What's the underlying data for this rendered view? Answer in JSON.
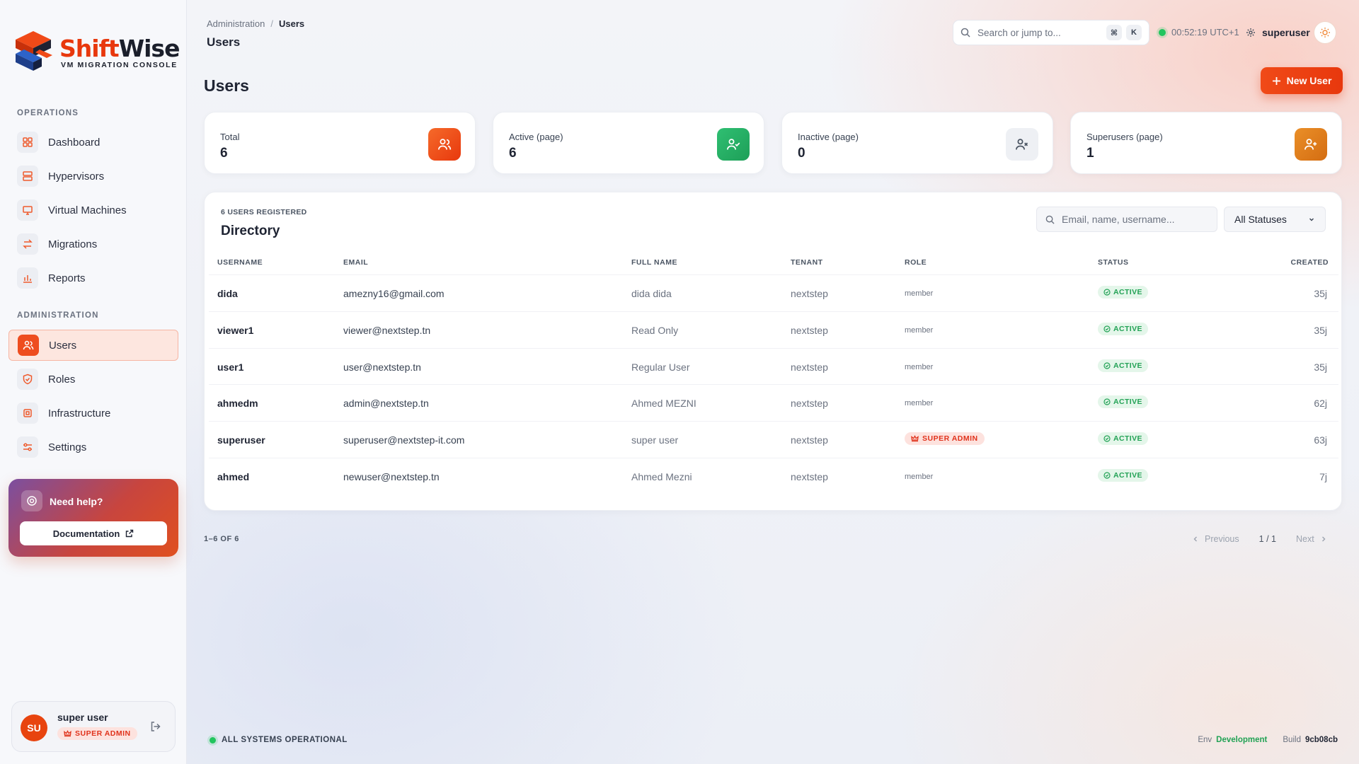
{
  "brand": {
    "name_part1": "Shift",
    "name_part2": "Wise",
    "subtitle": "VM MIGRATION CONSOLE",
    "accent_color": "#e8380d"
  },
  "sidebar": {
    "sections": [
      {
        "label": "OPERATIONS"
      },
      {
        "label": "ADMINISTRATION"
      }
    ],
    "items": [
      {
        "label": "Dashboard",
        "icon": "grid-icon"
      },
      {
        "label": "Hypervisors",
        "icon": "server-icon"
      },
      {
        "label": "Virtual Machines",
        "icon": "monitor-icon"
      },
      {
        "label": "Migrations",
        "icon": "swap-icon"
      },
      {
        "label": "Reports",
        "icon": "bar-chart-icon"
      },
      {
        "label": "Users",
        "icon": "users-icon",
        "active": true
      },
      {
        "label": "Roles",
        "icon": "shield-icon"
      },
      {
        "label": "Infrastructure",
        "icon": "cpu-icon"
      },
      {
        "label": "Settings",
        "icon": "sliders-icon"
      }
    ],
    "help": {
      "title": "Need help?",
      "button": "Documentation"
    },
    "user": {
      "initials": "SU",
      "name": "super user",
      "badge": "SUPER ADMIN"
    }
  },
  "header": {
    "breadcrumb": [
      "Administration",
      "Users"
    ],
    "title": "Users",
    "search_placeholder": "Search or jump to...",
    "shortcut": [
      "⌘",
      "K"
    ],
    "clock": "00:52:19 UTC+1",
    "username": "superuser"
  },
  "page": {
    "title": "Users",
    "new_button": "New User"
  },
  "stats": [
    {
      "label": "Total",
      "value": "6",
      "color": "#ee4d1f"
    },
    {
      "label": "Active (page)",
      "value": "6",
      "color": "#22a560"
    },
    {
      "label": "Inactive (page)",
      "value": "0",
      "color": "#eef0f4"
    },
    {
      "label": "Superusers (page)",
      "value": "1",
      "color": "#e07b1a"
    }
  ],
  "directory": {
    "kicker": "6 USERS REGISTERED",
    "title": "Directory",
    "search_placeholder": "Email, name, username...",
    "status_filter": "All Statuses",
    "columns": [
      "USERNAME",
      "EMAIL",
      "FULL NAME",
      "TENANT",
      "ROLE",
      "STATUS",
      "CREATED"
    ],
    "rows": [
      {
        "username": "dida",
        "email": "amezny16@gmail.com",
        "full_name": "dida dida",
        "tenant": "nextstep",
        "role": "member",
        "status": "ACTIVE",
        "created": "35j"
      },
      {
        "username": "viewer1",
        "email": "viewer@nextstep.tn",
        "full_name": "Read Only",
        "tenant": "nextstep",
        "role": "member",
        "status": "ACTIVE",
        "created": "35j"
      },
      {
        "username": "user1",
        "email": "user@nextstep.tn",
        "full_name": "Regular User",
        "tenant": "nextstep",
        "role": "member",
        "status": "ACTIVE",
        "created": "35j"
      },
      {
        "username": "ahmedm",
        "email": "admin@nextstep.tn",
        "full_name": "Ahmed MEZNI",
        "tenant": "nextstep",
        "role": "member",
        "status": "ACTIVE",
        "created": "62j"
      },
      {
        "username": "superuser",
        "email": "superuser@nextstep-it.com",
        "full_name": "super user",
        "tenant": "nextstep",
        "role": "SUPER ADMIN",
        "status": "ACTIVE",
        "created": "63j"
      },
      {
        "username": "ahmed",
        "email": "newuser@nextstep.tn",
        "full_name": "Ahmed Mezni",
        "tenant": "nextstep",
        "role": "member",
        "status": "ACTIVE",
        "created": "7j"
      }
    ]
  },
  "pagination": {
    "summary": "1–6 OF 6",
    "previous": "Previous",
    "page": "1 / 1",
    "next": "Next"
  },
  "footer": {
    "status": "ALL SYSTEMS OPERATIONAL",
    "env_label": "Env",
    "env_value": "Development",
    "build_label": "Build",
    "build_value": "9cb08cb"
  }
}
